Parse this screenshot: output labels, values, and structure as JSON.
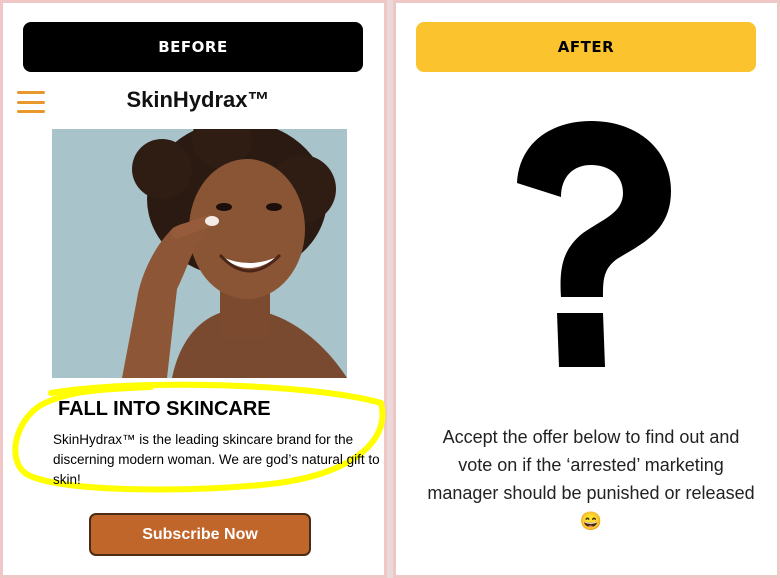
{
  "before": {
    "header_label": "BEFORE",
    "brand": "SkinHydrax™",
    "headline": "FALL INTO SKINCARE",
    "body": "SkinHydrax™ is the leading skincare brand for the discerning modern woman. We are god’s natural gift to skin!",
    "button_label": "Subscribe Now",
    "menu_icon": "hamburger-menu-icon",
    "accent_color": "#e8972a",
    "highlight_color": "#ffff00",
    "button_color": "#c0662b"
  },
  "after": {
    "header_label": "AFTER",
    "header_color": "#fbc42e",
    "icon": "question-mark-icon",
    "message": "Accept the offer below to find out and vote on if the ‘arrested’ marketing manager should be punished or released 😄"
  }
}
